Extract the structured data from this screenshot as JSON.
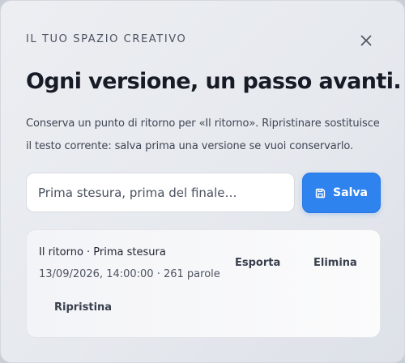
{
  "dialog": {
    "eyebrow": "IL TUO SPAZIO CREATIVO",
    "title": "Ogni versione, un passo avanti.",
    "description": "Conserva un punto di ritorno per «Il ritorno». Ripristinare sostituisce il testo corrente: salva prima una versione se vuoi conservarlo.",
    "close_icon": "close-icon"
  },
  "form": {
    "placeholder": "Prima stesura, prima del finale…",
    "value": "",
    "save_label": "Salva",
    "save_icon": "save-icon"
  },
  "versions": [
    {
      "name": "Il ritorno · Prima stesura",
      "meta": "13/09/2026, 14:00:00 · 261 parole",
      "export_label": "Esporta",
      "delete_label": "Elimina",
      "restore_label": "Ripristina"
    }
  ],
  "colors": {
    "accent": "#2f83ef",
    "title": "#161b26",
    "text": "#3e4553"
  }
}
